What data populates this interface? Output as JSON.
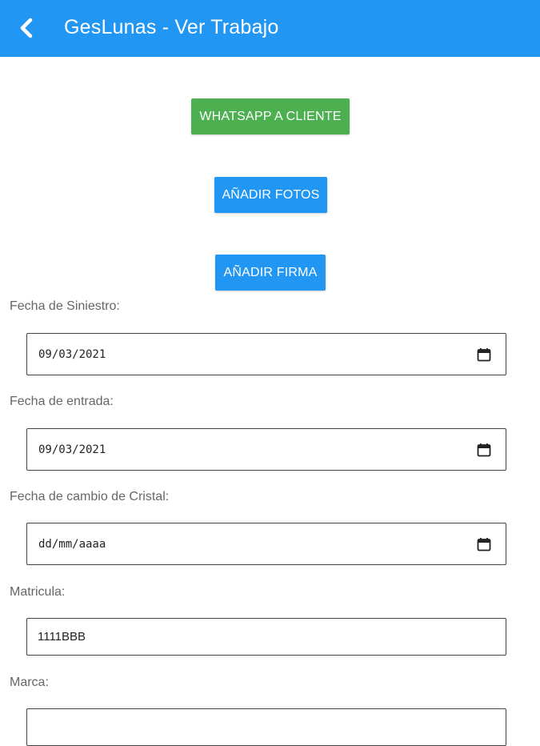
{
  "header": {
    "title": "GesLunas - Ver Trabajo",
    "back_icon": "chevron-left-icon"
  },
  "actions": {
    "whatsapp_label": "WHATSAPP A CLIENTE",
    "photos_label": "AÑADIR FOTOS",
    "signature_label": "AÑADIR FIRMA"
  },
  "form": {
    "fecha_siniestro": {
      "label": "Fecha de Siniestro:",
      "value": "09/03/2021"
    },
    "fecha_entrada": {
      "label": "Fecha de entrada:",
      "value": "09/03/2021"
    },
    "fecha_cambio": {
      "label": "Fecha de cambio de Cristal:",
      "value": "dd/mm/aaaa"
    },
    "matricula": {
      "label": "Matricula:",
      "value": "1111BBB"
    },
    "marca": {
      "label": "Marca:",
      "value": ""
    }
  },
  "colors": {
    "primary": "#2196F3",
    "success": "#4CAF50"
  }
}
